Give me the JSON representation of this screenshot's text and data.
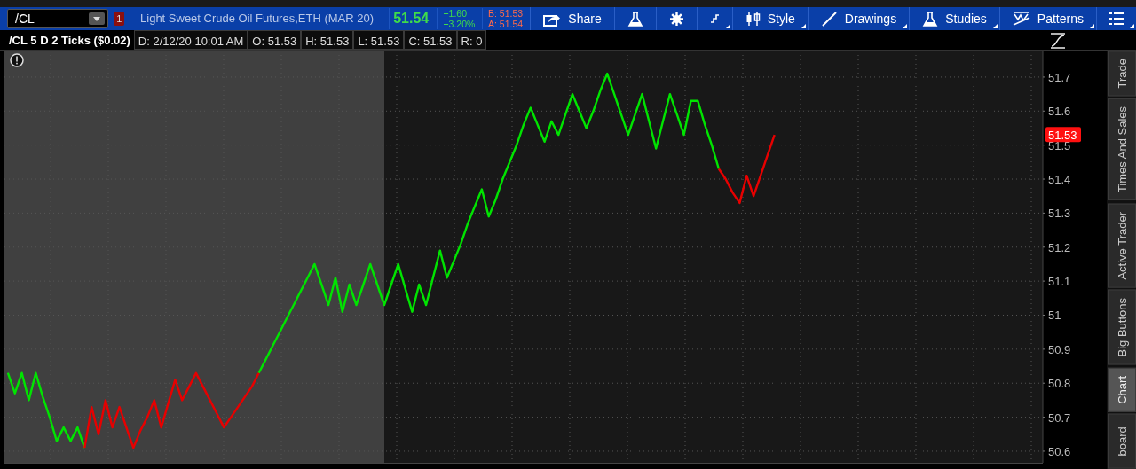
{
  "toolbar": {
    "symbol": "/CL",
    "link_badge": "1",
    "description": "Light Sweet Crude Oil Futures,ETH (MAR 20)",
    "last": "51.54",
    "change": "+1.60",
    "change_pct": "+3.20%",
    "bid": "B: 51.53",
    "ask": "A: 51.54",
    "buttons": [
      {
        "kind": "share",
        "label": "Share",
        "dropdown": false
      },
      {
        "kind": "flask",
        "dropdown": false
      },
      {
        "kind": "gear",
        "dropdown": false
      },
      {
        "kind": "step",
        "dropdown": true
      },
      {
        "kind": "candles",
        "label": "Style",
        "dropdown": true
      },
      {
        "kind": "line",
        "label": "Drawings",
        "dropdown": true
      },
      {
        "kind": "flask",
        "label": "Studies",
        "dropdown": true
      },
      {
        "kind": "pattern",
        "label": "Patterns",
        "dropdown": true
      },
      {
        "kind": "list",
        "dropdown": true
      }
    ]
  },
  "info_bar": {
    "title": "/CL 5 D 2 Ticks ($0.02)",
    "fields": [
      "D: 2/12/20 10:01 AM",
      "O: 51.53",
      "H: 51.53",
      "L: 51.53",
      "C: 51.53",
      "R: 0"
    ]
  },
  "chart": {
    "chart_data": {
      "type": "line",
      "categories": [
        null,
        null,
        null,
        null,
        null,
        null,
        null,
        null,
        null,
        null,
        null,
        null,
        null,
        null,
        null,
        null,
        null,
        null,
        null,
        null,
        null,
        null,
        null,
        null,
        null,
        null,
        null,
        null,
        null,
        null,
        null,
        null,
        null,
        null,
        null,
        null,
        null,
        null,
        null,
        null,
        null,
        null,
        null,
        null,
        null,
        null,
        null,
        null,
        null,
        null,
        null,
        null,
        null,
        null,
        null,
        null,
        null,
        null,
        null,
        null,
        null,
        null,
        null,
        null,
        null,
        null,
        null,
        null,
        null,
        null,
        null,
        null,
        null,
        null,
        null,
        null,
        null,
        null,
        null,
        null,
        null,
        null,
        null,
        null,
        null,
        null,
        null,
        null,
        null,
        null,
        null,
        null,
        null,
        null,
        null,
        null,
        null,
        null,
        null,
        null,
        null,
        null,
        null,
        null,
        null,
        null,
        null,
        null,
        null,
        null,
        null,
        null,
        null,
        null,
        null,
        null,
        null,
        null,
        null,
        null,
        null,
        null,
        null,
        null,
        null,
        null,
        null,
        null,
        null,
        null,
        null,
        null,
        null,
        null,
        null,
        null,
        null,
        null,
        null,
        null,
        null,
        null,
        null,
        null,
        null,
        null,
        null,
        null,
        null
      ],
      "grid": true,
      "ylim": [
        50.566,
        51.778
      ],
      "yticks": [
        50.6,
        50.7,
        50.8,
        50.9,
        51,
        51.1,
        51.2,
        51.3,
        51.4,
        51.5,
        51.6,
        51.7
      ],
      "series": [
        {
          "color": "#00e400",
          "values": [
            50.83,
            50.77,
            50.83,
            50.75,
            50.83,
            50.76,
            50.7,
            50.63,
            50.67,
            50.63,
            50.67,
            50.61,
            null,
            null,
            null,
            null,
            null,
            null,
            null,
            null,
            null,
            null,
            null,
            null,
            null,
            null,
            null,
            null,
            null,
            null,
            null,
            null,
            null,
            null,
            null,
            null,
            50.83,
            50.87,
            50.91,
            50.95,
            50.99,
            51.03,
            51.07,
            51.11,
            51.15,
            51.09,
            51.03,
            51.11,
            51.01,
            51.09,
            51.03,
            51.09,
            51.15,
            51.09,
            51.03,
            51.09,
            51.15,
            51.08,
            51.01,
            51.09,
            51.03,
            51.11,
            51.19,
            51.11,
            51.16,
            51.21,
            51.27,
            51.32,
            51.37,
            51.29,
            51.34,
            51.4,
            51.45,
            51.5,
            51.56,
            51.61,
            51.56,
            51.51,
            51.57,
            51.53,
            51.59,
            51.65,
            51.6,
            51.55,
            51.6,
            51.66,
            51.71,
            51.65,
            51.59,
            51.53,
            51.59,
            51.65,
            51.57,
            51.49,
            51.57,
            51.65,
            51.59,
            51.53,
            51.63,
            51.63,
            51.56,
            51.5,
            51.43,
            null,
            null,
            null,
            null,
            null,
            null,
            null,
            null,
            null,
            null,
            null,
            null,
            null,
            null,
            null,
            null,
            null,
            null,
            null,
            null,
            null,
            null,
            null,
            null,
            null,
            null,
            null,
            null,
            null,
            null,
            null,
            null,
            null,
            null,
            null,
            null,
            null,
            null,
            null,
            null,
            null,
            null,
            null,
            null,
            null,
            null
          ]
        },
        {
          "color": "#e80000",
          "values": [
            null,
            null,
            null,
            null,
            null,
            null,
            null,
            null,
            null,
            null,
            null,
            50.61,
            50.73,
            50.65,
            50.75,
            50.67,
            50.73,
            50.67,
            50.61,
            50.66,
            50.7,
            50.75,
            50.67,
            50.74,
            50.81,
            50.75,
            50.79,
            50.83,
            50.79,
            50.75,
            50.71,
            50.67,
            50.7,
            50.73,
            50.76,
            50.79,
            50.83,
            null,
            null,
            null,
            null,
            null,
            null,
            null,
            null,
            null,
            null,
            null,
            null,
            null,
            null,
            null,
            null,
            null,
            null,
            null,
            null,
            null,
            null,
            null,
            null,
            null,
            null,
            null,
            null,
            null,
            null,
            null,
            null,
            null,
            null,
            null,
            null,
            null,
            null,
            null,
            null,
            null,
            null,
            null,
            null,
            null,
            null,
            null,
            null,
            null,
            null,
            null,
            null,
            null,
            null,
            null,
            null,
            null,
            null,
            null,
            null,
            null,
            null,
            null,
            null,
            null,
            51.43,
            51.4,
            51.36,
            51.33,
            51.41,
            51.35,
            51.41,
            51.47,
            51.53,
            null,
            null,
            null,
            null,
            null,
            null,
            null,
            null,
            null,
            null,
            null,
            null,
            null,
            null,
            null,
            null,
            null,
            null,
            null,
            null,
            null,
            null,
            null,
            null,
            null,
            null,
            null,
            null,
            null,
            null,
            null,
            null,
            null,
            null,
            null,
            null,
            null,
            null
          ]
        }
      ],
      "annotations": [
        {
          "text": "51.53"
        }
      ]
    }
  },
  "side_tabs": [
    {
      "label": "Trade",
      "selected": false
    },
    {
      "label": "Times And Sales",
      "selected": false
    },
    {
      "label": "Active Trader",
      "selected": false
    },
    {
      "label": "Big Buttons",
      "selected": false
    },
    {
      "label": "Chart",
      "selected": true
    },
    {
      "label": "board",
      "selected": false
    }
  ]
}
